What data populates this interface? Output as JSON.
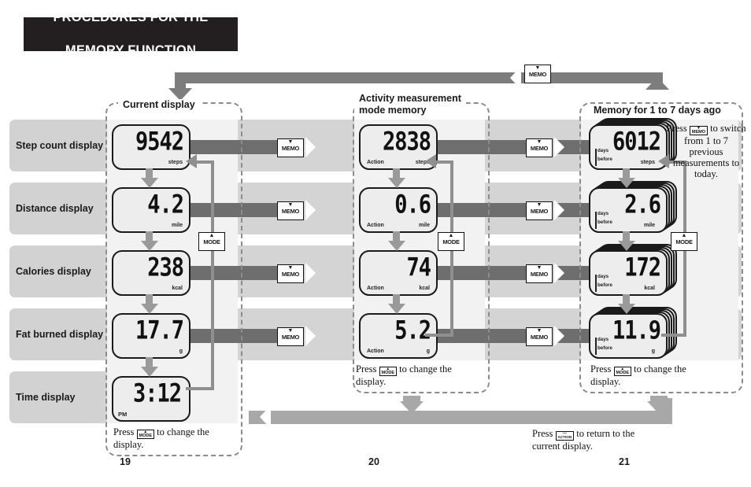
{
  "title": {
    "line1": "PROCEDURES FOR THE",
    "line2": "MEMORY FUNCTION"
  },
  "columns": {
    "current": {
      "caption": "Current display",
      "page": "19"
    },
    "activity": {
      "caption_line1": "Activity measurement",
      "caption_line2": "mode memory",
      "page": "20"
    },
    "memory": {
      "caption": "Memory for 1 to 7 days ago",
      "page": "21"
    }
  },
  "rows": [
    {
      "label": "Step count display"
    },
    {
      "label": "Distance display"
    },
    {
      "label": "Calories display"
    },
    {
      "label": "Fat burned display"
    },
    {
      "label": "Time display"
    }
  ],
  "displays": {
    "current": [
      {
        "value": "9542",
        "unit": "steps"
      },
      {
        "value": "4.2",
        "unit": "mile"
      },
      {
        "value": "238",
        "unit": "kcal"
      },
      {
        "value": "17.7",
        "unit": "g"
      },
      {
        "value": "3:12",
        "unit": "PM"
      }
    ],
    "activity": [
      {
        "value": "2838",
        "unit": "steps",
        "mode": "Action"
      },
      {
        "value": "0.6",
        "unit": "mile",
        "mode": "Action"
      },
      {
        "value": "74",
        "unit": "kcal",
        "mode": "Action"
      },
      {
        "value": "5.2",
        "unit": "g",
        "mode": "Action"
      }
    ],
    "memory": [
      {
        "value": "6012",
        "unit": "steps",
        "days_line1": "days",
        "days_line2": "before"
      },
      {
        "value": "2.6",
        "unit": "mile",
        "days_line1": "days",
        "days_line2": "before"
      },
      {
        "value": "172",
        "unit": "kcal",
        "days_line1": "days",
        "days_line2": "before"
      },
      {
        "value": "11.9",
        "unit": "g",
        "days_line1": "days",
        "days_line2": "before"
      }
    ]
  },
  "buttons": {
    "memo_label": "MEMO",
    "memo_triangle": "▼",
    "mode_label": "MODE",
    "mode_triangle": "▲",
    "action_label": "ACTION",
    "action_triangle": "—"
  },
  "notes": {
    "memo_switch": {
      "press": "Press",
      "btn": "MEMO",
      "rest_line1": "to switch",
      "rest_line2": "from 1 to 7 previous",
      "rest_line3": "measurements to",
      "rest_line4": "today."
    },
    "mode_change": {
      "press": "Press",
      "btn": "MODE",
      "rest_line1": "to change the",
      "rest_line2": "display."
    },
    "action_return": {
      "press": "Press",
      "btn": "ACTION",
      "rest_line1": "to return to the",
      "rest_line2": "current display."
    }
  },
  "colors": {
    "title_bg": "#231f20",
    "band": "#d4d4d4",
    "band_alt": "#f2f2f2",
    "arrow": "#6e6e6e",
    "route": "#7d7d7d",
    "route_light": "#a8a8a8"
  }
}
